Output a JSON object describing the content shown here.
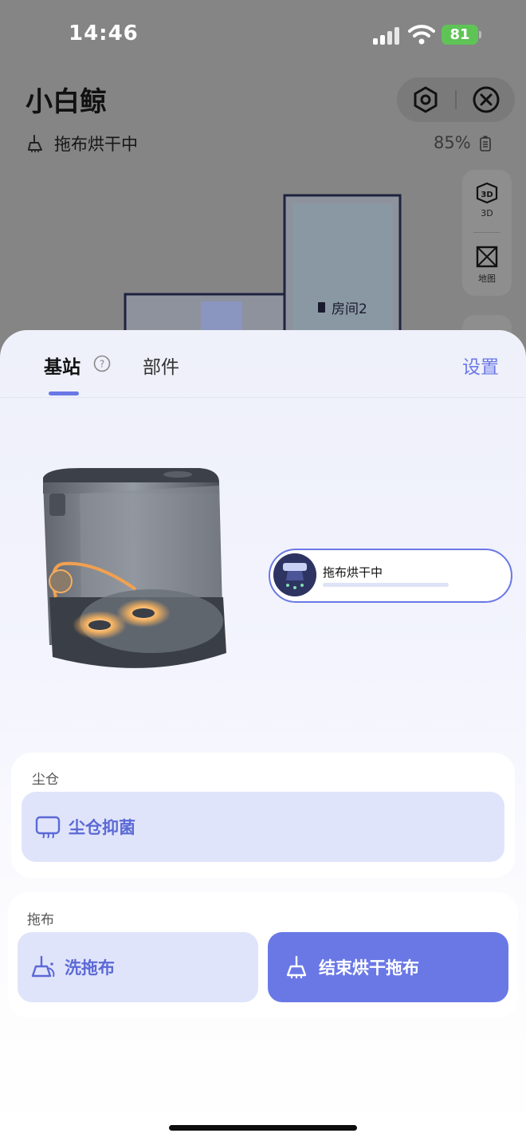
{
  "status_bar": {
    "time": "14:46",
    "battery": "81"
  },
  "header": {
    "device_name": "小白鲸",
    "status_text": "拖布烘干中",
    "battery_percent": "85%"
  },
  "view_toggle": {
    "btn_3d": "3D",
    "btn_map": "地图"
  },
  "map": {
    "room_label": "房间2"
  },
  "tabs": {
    "station": "基站",
    "parts": "部件",
    "settings": "设置"
  },
  "station_status": {
    "text": "拖布烘干中",
    "progress": 0.0
  },
  "dust_bin": {
    "title": "尘仓",
    "button": "尘仓抑菌"
  },
  "mop": {
    "title": "拖布",
    "wash_button": "洗拖布",
    "end_dry_button": "结束烘干拖布"
  },
  "colors": {
    "accent": "#6a78e6",
    "accent_light": "#e0e4fa",
    "battery_green": "#5ec456"
  }
}
